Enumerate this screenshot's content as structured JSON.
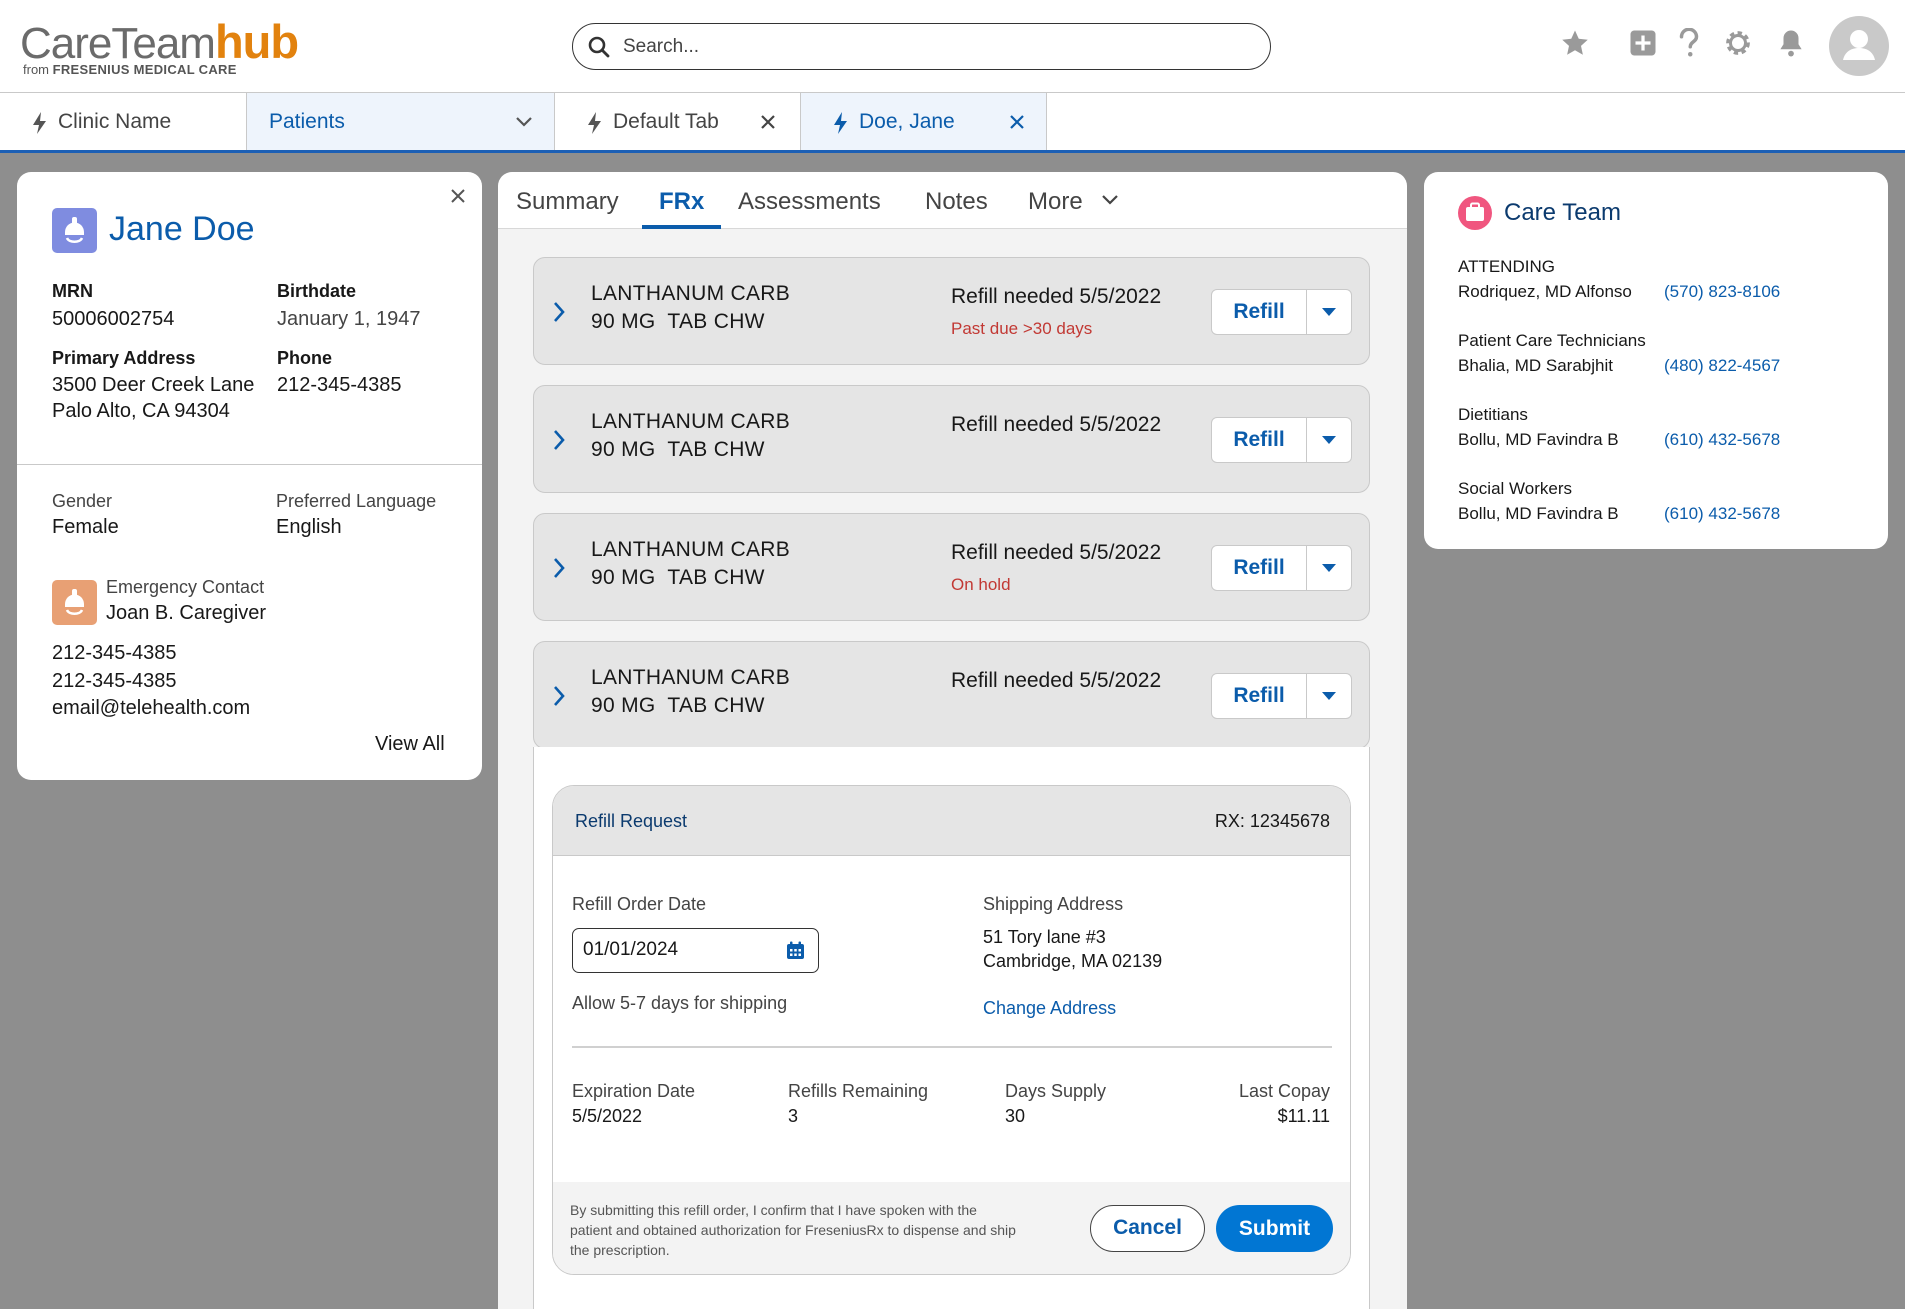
{
  "header": {
    "logo_left": "CareTeam",
    "logo_right": "hub",
    "logo_from": "from",
    "logo_company": "FRESENIUS MEDICAL CARE",
    "search_placeholder": "Search...",
    "accent": "#e2820e"
  },
  "tabs": {
    "clinic": "Clinic Name",
    "patients": "Patients",
    "default_tab": "Default Tab",
    "doe_jane": "Doe, Jane"
  },
  "patient": {
    "name": "Jane Doe",
    "mrn_label": "MRN",
    "mrn": "50006002754",
    "birthdate_label": "Birthdate",
    "birthdate": "January 1, 1947",
    "address_label": "Primary Address",
    "address_line1": "3500 Deer Creek Lane",
    "address_line2": "Palo Alto, CA 94304",
    "phone_label": "Phone",
    "phone": "212-345-4385",
    "gender_label": "Gender",
    "gender": "Female",
    "language_label": "Preferred Language",
    "language": "English",
    "emergency_label": "Emergency Contact",
    "emergency_name": "Joan B. Caregiver",
    "emergency_phone1": "212-345-4385",
    "emergency_phone2": "212-345-4385",
    "emergency_email": "email@telehealth.com",
    "view_all": "View All"
  },
  "center_tabs": {
    "summary": "Summary",
    "frx": "FRx",
    "assessments": "Assessments",
    "notes": "Notes",
    "more": "More"
  },
  "prescriptions": [
    {
      "drug_line1": "LANTHANUM CARB",
      "drug_line2": "90 MG  TAB CHW",
      "need": "Refill needed 5/5/2022",
      "status": "Past due >30 days",
      "button": "Refill"
    },
    {
      "drug_line1": "LANTHANUM CARB",
      "drug_line2": "90 MG  TAB CHW",
      "need": "Refill needed 5/5/2022",
      "status": "",
      "button": "Refill"
    },
    {
      "drug_line1": "LANTHANUM CARB",
      "drug_line2": "90 MG  TAB CHW",
      "need": "Refill needed 5/5/2022",
      "status": "On hold",
      "button": "Refill"
    },
    {
      "drug_line1": "LANTHANUM CARB",
      "drug_line2": "90 MG  TAB CHW",
      "need": "Refill needed 5/5/2022",
      "status": "",
      "button": "Refill"
    }
  ],
  "refill_request": {
    "title": "Refill Request",
    "rx_number": "RX: 12345678",
    "order_date_label": "Refill Order Date",
    "order_date": "01/01/2024",
    "shipping_note": "Allow 5-7 days for shipping",
    "shipping_label": "Shipping Address",
    "shipping_line1": "51 Tory lane #3",
    "shipping_line2": "Cambridge, MA 02139",
    "change_address": "Change Address",
    "expiration_label": "Expiration Date",
    "expiration": "5/5/2022",
    "refills_label": "Refills Remaining",
    "refills": "3",
    "days_label": "Days Supply",
    "days": "30",
    "copay_label": "Last Copay",
    "copay": "$11.11",
    "disclaimer_line1": "By submitting this refill order, I confirm that I have spoken with the",
    "disclaimer_line2": "patient and obtained authorization for FreseniusRx to dispense and ship",
    "disclaimer_line3": "the prescription.",
    "cancel": "Cancel",
    "submit": "Submit"
  },
  "care_team": {
    "title": "Care Team",
    "members": [
      {
        "role": "ATTENDING",
        "name": "Rodriquez, MD Alfonso",
        "phone": "(570) 823-8106"
      },
      {
        "role": "Patient Care Technicians",
        "name": "Bhalia, MD Sarabjhit",
        "phone": "(480) 822-4567"
      },
      {
        "role": "Dietitians",
        "name": "Bollu, MD Favindra B",
        "phone": "(610) 432-5678"
      },
      {
        "role": "Social Workers",
        "name": "Bollu, MD Favindra B",
        "phone": "(610) 432-5678"
      }
    ]
  },
  "colors": {
    "link_blue": "#0b5cab",
    "primary_button": "#0176d3",
    "warning_red": "#c23934",
    "patient_icon": "#7f8ce0",
    "contact_icon": "#e8a074",
    "care_team_icon": "#f0567f"
  },
  "icons": [
    "search-icon",
    "star-icon",
    "add-icon",
    "help-icon",
    "gear-icon",
    "bell-icon",
    "user-avatar-icon",
    "lightning-icon",
    "chevron-down-icon",
    "close-icon",
    "chevron-right-icon",
    "caret-down-icon",
    "calendar-icon",
    "patient-icon",
    "emergency-contact-icon",
    "care-team-icon"
  ]
}
